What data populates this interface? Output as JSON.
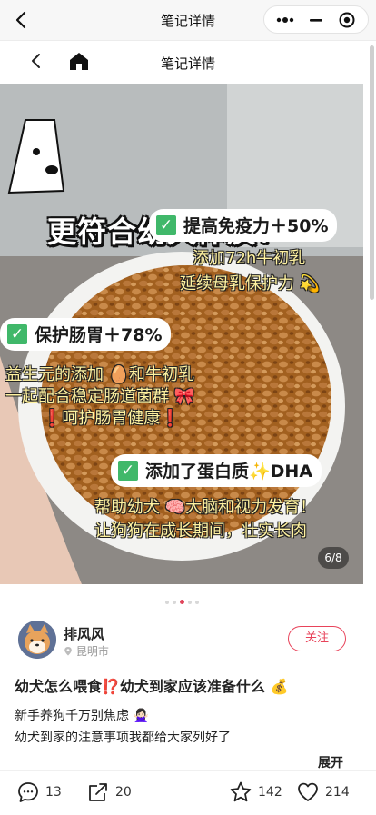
{
  "window": {
    "title": "笔记详情"
  },
  "nav": {
    "title": "笔记详情"
  },
  "photo": {
    "headline": "更符合幼犬体质！",
    "check_glyph": "✓",
    "pill1": "提高免疫力＋50%",
    "caption1_line1": "添加72h牛初乳",
    "caption1_line2": "延续母乳保护力 💫",
    "pill2": "保护肠胃＋78%",
    "caption2_line1": "益生元的添加 🥚和牛初乳",
    "caption2_line2": "一起配合稳定肠道菌群 🎀",
    "caption2_line3": "❗️呵护肠胃健康❗️",
    "pill3": "添加了蛋白质✨DHA",
    "caption3_line1": "帮助幼犬 🧠大脑和视力发育！",
    "caption3_line2": "让狗狗在成长期间，壮实长肉",
    "page_indicator": "6/8",
    "current_page": 6,
    "total_pages": 8
  },
  "author": {
    "name": "排风风",
    "location": "昆明市",
    "follow_label": "关注"
  },
  "post": {
    "title": "幼犬怎么喂食⁉️幼犬到家应该准备什么 💰",
    "line1": "新手养狗千万别焦虑 🙅🏻‍♀️",
    "line2": "幼犬到家的注意事项我都给大家列好了",
    "expand_label": "展开"
  },
  "actions": {
    "comment_count": "13",
    "share_count": "20",
    "star_count": "142",
    "like_count": "214"
  },
  "colors": {
    "accent": "#e8435a",
    "check_green": "#40b86a",
    "caption_yellow": "#fff2a0"
  }
}
